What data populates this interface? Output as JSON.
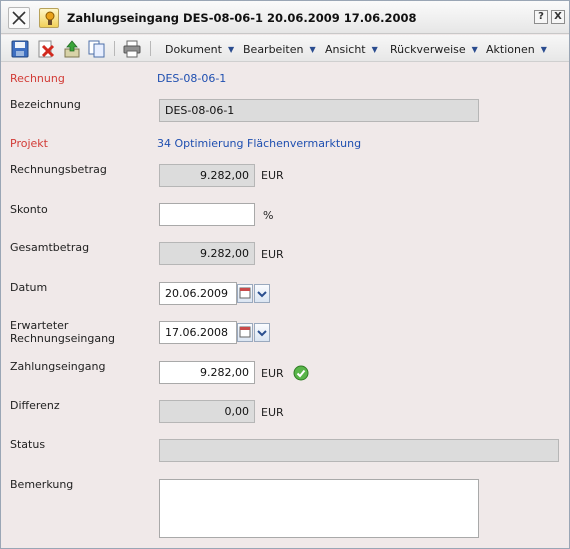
{
  "title": "Zahlungseingang DES-08-06-1 20.06.2009 17.06.2008",
  "title_buttons": {
    "help": "?",
    "close": "X"
  },
  "toolbar": {
    "menus": [
      "Dokument",
      "Bearbeiten",
      "Ansicht",
      "Rückverweise",
      "Aktionen"
    ]
  },
  "form": {
    "rechnung": {
      "label": "Rechnung",
      "value": "DES-08-06-1"
    },
    "bezeichnung": {
      "label": "Bezeichnung",
      "value": "DES-08-06-1"
    },
    "projekt": {
      "label": "Projekt",
      "value": "34 Optimierung Flächenvermarktung"
    },
    "rechnungsbetrag": {
      "label": "Rechnungsbetrag",
      "value": "9.282,00",
      "unit": "EUR"
    },
    "skonto": {
      "label": "Skonto",
      "value": "",
      "unit": "%"
    },
    "gesamtbetrag": {
      "label": "Gesamtbetrag",
      "value": "9.282,00",
      "unit": "EUR"
    },
    "datum": {
      "label": "Datum",
      "value": "20.06.2009"
    },
    "erwarteter": {
      "label_line1": "Erwarteter",
      "label_line2": "Rechnungseingang",
      "value": "17.06.2008"
    },
    "zahlungseingang": {
      "label": "Zahlungseingang",
      "value": "9.282,00",
      "unit": "EUR"
    },
    "differenz": {
      "label": "Differenz",
      "value": "0,00",
      "unit": "EUR"
    },
    "status": {
      "label": "Status",
      "value": ""
    },
    "bemerkung": {
      "label": "Bemerkung",
      "value": ""
    }
  },
  "colors": {
    "form_background": "#f0e9e9",
    "required_label": "#d23b36",
    "link": "#1f4fb0",
    "readonly_field": "#dcdcdc"
  },
  "icons": {
    "toolbar": [
      "save-icon",
      "delete-icon",
      "export-icon",
      "copy-icon",
      "print-icon"
    ],
    "ok": "check-circle-icon"
  }
}
